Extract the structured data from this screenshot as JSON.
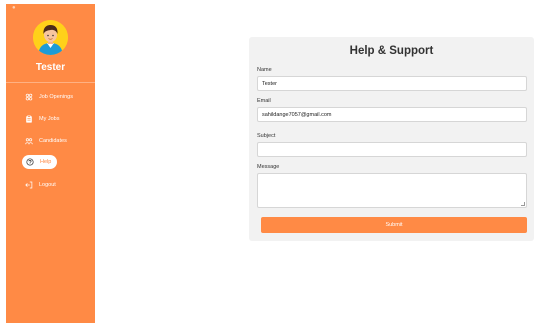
{
  "sidebar": {
    "user_name": "Tester",
    "accent_color": "#ff8a45",
    "items": [
      {
        "label": "Job Openings",
        "icon": "people-group-icon"
      },
      {
        "label": "My Jobs",
        "icon": "clipboard-icon"
      },
      {
        "label": "Candidates",
        "icon": "users-icon"
      },
      {
        "label": "Help",
        "icon": "question-circle-icon",
        "active": true
      },
      {
        "label": "Logout",
        "icon": "logout-icon"
      }
    ]
  },
  "help_form": {
    "title": "Help & Support",
    "name_label": "Name",
    "name_value": "Tester",
    "email_label": "Email",
    "email_value": "sahildange7057@gmail.com",
    "subject_label": "Subject",
    "subject_value": "",
    "message_label": "Message",
    "message_value": "",
    "submit_label": "Submit"
  }
}
